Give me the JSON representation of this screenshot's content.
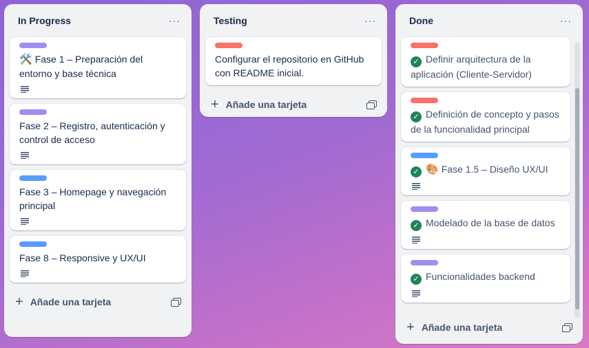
{
  "colors": {
    "label_purple": "#9f8fef",
    "label_red": "#f87168",
    "label_blue": "#579dff",
    "check_green": "#1f845a"
  },
  "lists": [
    {
      "title": "In Progress",
      "menu": "···",
      "add_card": "Añade una tarjeta",
      "cards": [
        {
          "label": "purple",
          "emoji": "🛠️",
          "title": "Fase 1 – Preparación del entorno y base técnica",
          "has_description": true
        },
        {
          "label": "purple",
          "title": "Fase 2 – Registro, autenticación y control de acceso",
          "has_description": true
        },
        {
          "label": "blue",
          "title": "Fase 3 – Homepage y navegación principal",
          "has_description": true
        },
        {
          "label": "blue",
          "title": "Fase 8 – Responsive y UX/UI",
          "has_description": true
        }
      ]
    },
    {
      "title": "Testing",
      "menu": "···",
      "add_card": "Añade una tarjeta",
      "cards": [
        {
          "label": "red",
          "title": "Configurar el repositorio en GitHub con README inicial.",
          "has_description": false
        }
      ]
    },
    {
      "title": "Done",
      "menu": "···",
      "add_card": "Añade una tarjeta",
      "cards": [
        {
          "label": "red",
          "done": true,
          "title": "Definir arquitectura de la aplicación (Cliente-Servidor)",
          "has_description": false
        },
        {
          "label": "red",
          "done": true,
          "title": "Definición de concepto y pasos de la funcionalidad principal",
          "has_description": false
        },
        {
          "label": "blue",
          "done": true,
          "emoji": "🎨",
          "title": "Fase 1.5 – Diseño UX/UI",
          "has_description": true
        },
        {
          "label": "purple",
          "done": true,
          "title": "Modelado de la base de datos",
          "has_description": true
        },
        {
          "label": "purple",
          "done": true,
          "title": "Funcionalidades backend",
          "has_description": true
        }
      ]
    }
  ]
}
